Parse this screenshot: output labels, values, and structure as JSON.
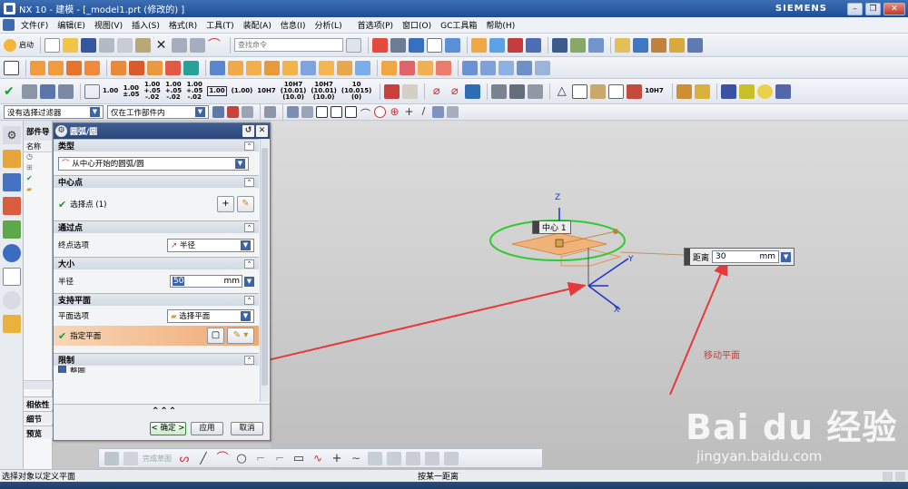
{
  "window": {
    "title": "NX 10 - 建模 - [_model1.prt  (修改的) ]",
    "brand": "SIEMENS",
    "min": "–",
    "restore": "❐",
    "close": "✕"
  },
  "menu": [
    "文件(F)",
    "编辑(E)",
    "视图(V)",
    "插入(S)",
    "格式(R)",
    "工具(T)",
    "装配(A)",
    "信息(I)",
    "分析(L)",
    "首选项(P)",
    "窗口(O)",
    "GC工具箱",
    "帮助(H)"
  ],
  "toolbar": {
    "start_label": "启动",
    "search_placeholder": "查找命令",
    "tolerances": [
      "1.00",
      "1.00\n±.05",
      "1.00\n+.05\n-.02",
      "1.00\n+.05\n-.02",
      "1.00\n+.05\n-.02",
      "1.00",
      "(1.00)",
      "10H7",
      "10H7\n(10.01)\n(10.0)",
      "10H7\n(10.01)\n(10.0)",
      "10\n(10.015)\n(0)"
    ],
    "fit_label": "10H7"
  },
  "filter": {
    "selection": "没有选择过滤器",
    "scope": "仅在工作部件内"
  },
  "partnav": {
    "header": "部件导",
    "name_col": "名称",
    "panes": [
      "相依性",
      "细节",
      "预览"
    ]
  },
  "dialog": {
    "title": "圆弧/圆",
    "sections": {
      "type": {
        "title": "类型",
        "value": "从中心开始的圆弧/圆"
      },
      "center": {
        "title": "中心点",
        "label": "选择点 (1)"
      },
      "through": {
        "title": "通过点",
        "label": "终点选项",
        "value": "半径"
      },
      "size": {
        "title": "大小",
        "label": "半径",
        "value": "50",
        "unit": "mm"
      },
      "plane": {
        "title": "支持平面",
        "label": "平面选项",
        "value": "选择平面",
        "specify": "指定平面"
      },
      "limit": {
        "title": "限制",
        "checkbox": "整圆"
      }
    },
    "buttons": {
      "ok": "< 确定 >",
      "apply": "应用",
      "cancel": "取消"
    }
  },
  "viewport": {
    "center_tag": "中心 1",
    "axis_x": "X",
    "axis_y": "Y",
    "axis_z": "Z",
    "distance_label": "距离",
    "distance_value": "30",
    "distance_unit": "mm",
    "annotation": "移动平面"
  },
  "sketchbar": {
    "finish_label": "完成草图"
  },
  "status": {
    "left": "选择对象以定义平面",
    "center": "按某一距离"
  },
  "watermark": {
    "brand": "Bai du 经验",
    "url": "jingyan.baidu.com"
  }
}
